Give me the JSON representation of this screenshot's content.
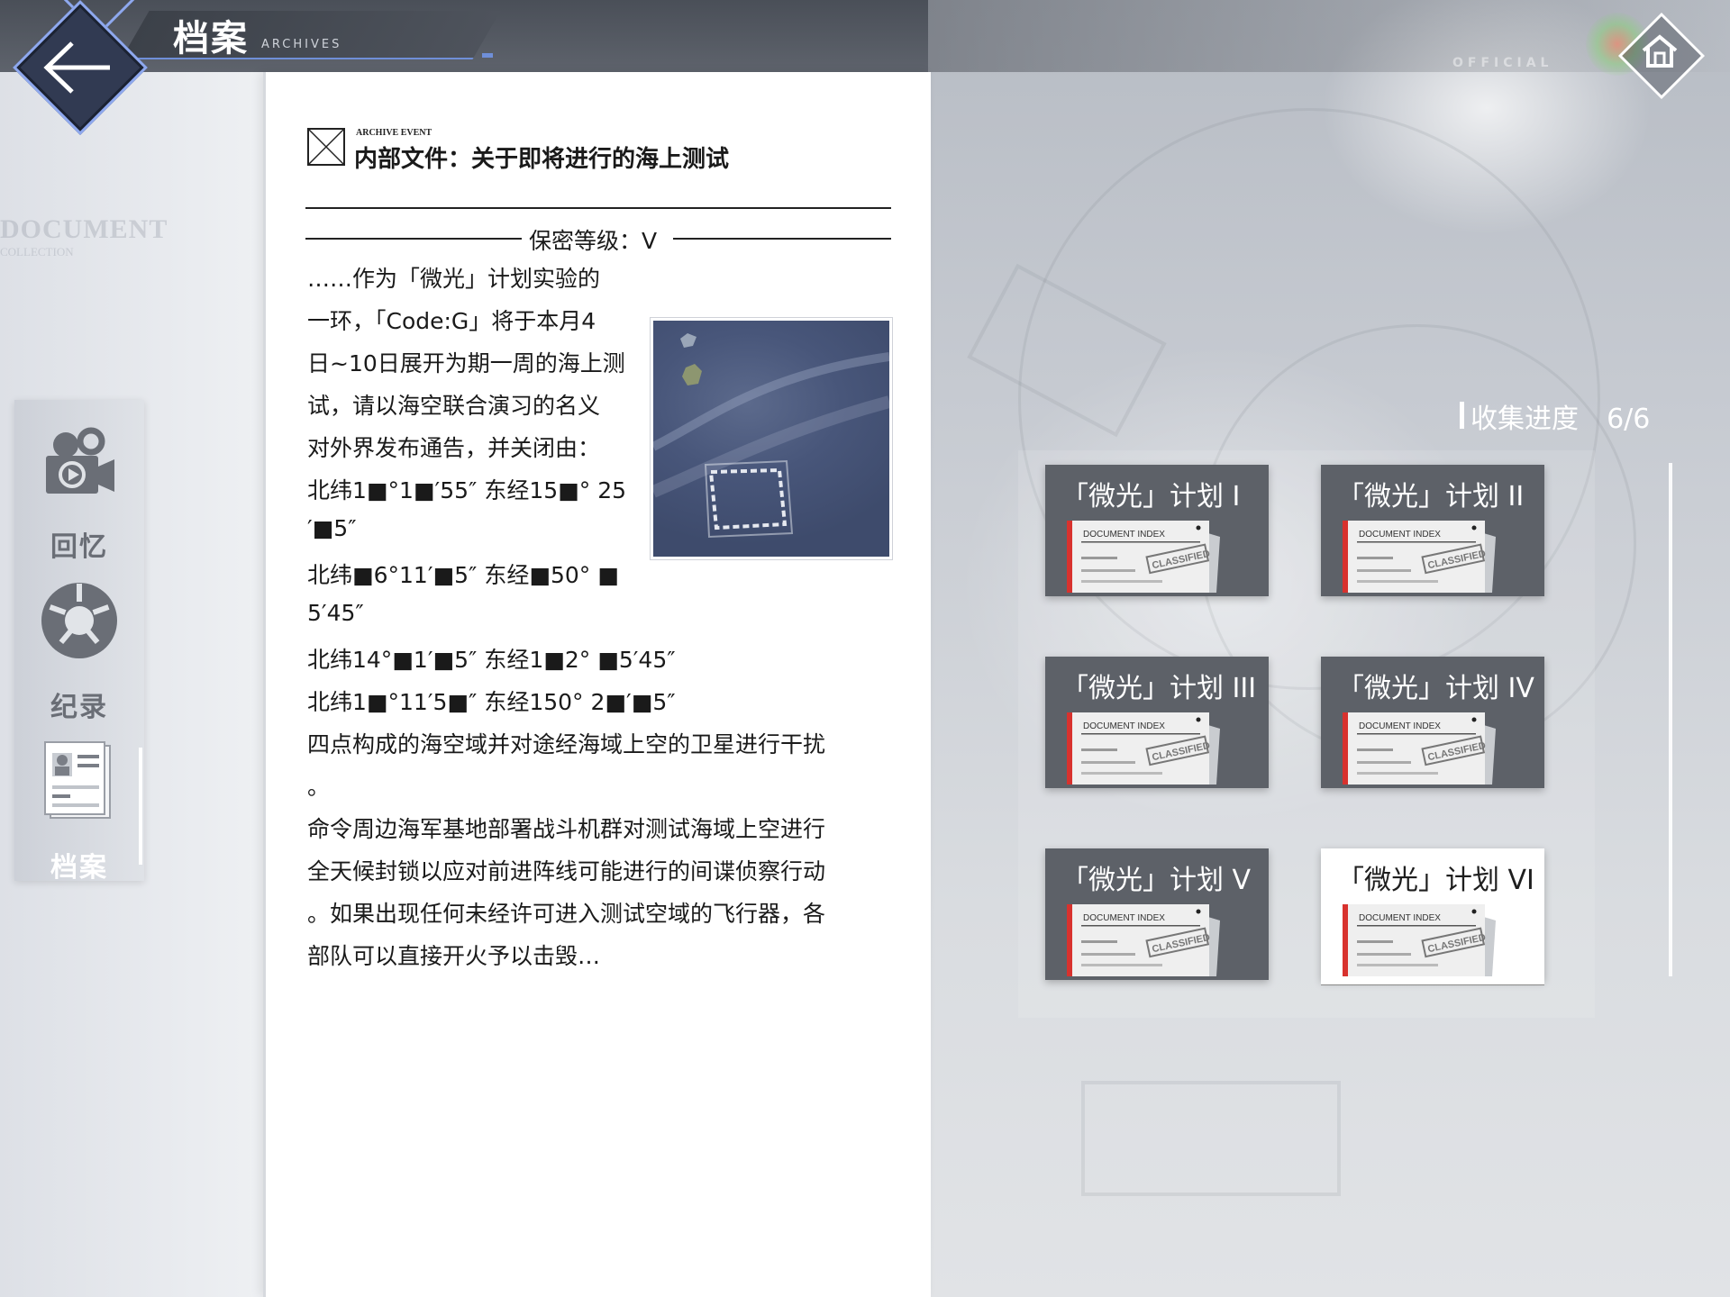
{
  "header": {
    "title": "档案",
    "subtitle": "ARCHIVES",
    "official_label": "OFFICIAL"
  },
  "sidebar": {
    "ghost_title": "DOCUMENT",
    "ghost_subtitle": "COLLECTION",
    "items": [
      {
        "label": "回忆",
        "icon": "camera-icon"
      },
      {
        "label": "纪录",
        "icon": "film-reel-icon"
      },
      {
        "label": "档案",
        "icon": "document-icon",
        "active": true
      }
    ]
  },
  "document": {
    "event_label": "ARCHIVE EVENT",
    "title": "内部文件：关于即将进行的海上测试",
    "security_level": "保密等级：V",
    "lines": [
      "……作为「微光」计划实验的",
      "一环，「Code:G」将于本月4",
      "日~10日展开为期一周的海上测",
      "试，请以海空联合演习的名义",
      "对外界发布通告，并关闭由：",
      "北纬1■°1■′55″ 东经15■° 25",
      "′■5″",
      "北纬■6°11′■5″ 东经■50° ■",
      "5′45″",
      "北纬14°■1′■5″ 东经1■2° ■5′45″",
      "北纬1■°11′5■″ 东经150° 2■′■5″",
      "四点构成的海空域并对途经海域上空的卫星进行干扰",
      "。",
      "命令周边海军基地部署战斗机群对测试海域上空进行",
      "全天候封锁以应对前进阵线可能进行的间谍侦察行动",
      "。如果出现任何未经许可进入测试空域的飞行器，各",
      "部队可以直接开火予以击毁…"
    ]
  },
  "collection": {
    "progress_label": "收集进度",
    "progress_value": "6/6",
    "cards": [
      {
        "title": "「微光」计划 I",
        "selected": false
      },
      {
        "title": "「微光」计划 II",
        "selected": false
      },
      {
        "title": "「微光」计划 III",
        "selected": false
      },
      {
        "title": "「微光」计划 IV",
        "selected": false
      },
      {
        "title": "「微光」计划 V",
        "selected": false
      },
      {
        "title": "「微光」计划 VI",
        "selected": true
      }
    ],
    "card_paper": {
      "heading": "DOCUMENT INDEX",
      "stamp": "CLASSIFIED"
    }
  },
  "colors": {
    "accent_blue": "#8ea8ee",
    "card_dark": "#5d6168",
    "card_selected": "#ffffff",
    "paper_red_stripe": "#d8322e"
  }
}
